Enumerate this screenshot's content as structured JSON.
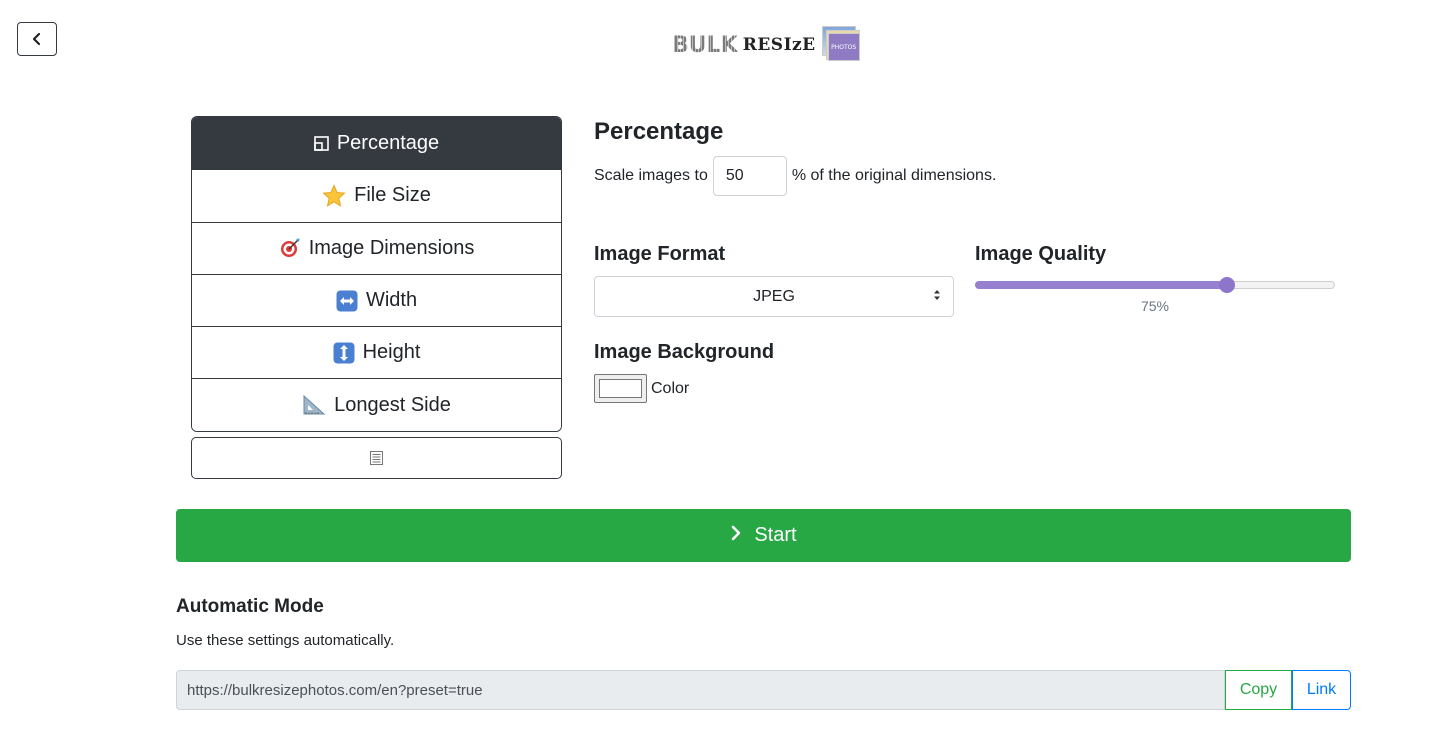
{
  "header": {
    "logo_bulk": "BULK",
    "logo_resize": "RESIzE",
    "logo_photos": "PHOTOS"
  },
  "menu": {
    "items": [
      {
        "label": "Percentage",
        "icon": "percentage-icon"
      },
      {
        "label": "File Size",
        "icon": "star-icon"
      },
      {
        "label": "Image Dimensions",
        "icon": "target-icon"
      },
      {
        "label": "Width",
        "icon": "left-right-arrow-icon"
      },
      {
        "label": "Height",
        "icon": "up-down-arrow-icon"
      },
      {
        "label": "Longest Side",
        "icon": "triangle-ruler-icon"
      }
    ]
  },
  "percentage": {
    "title": "Percentage",
    "prefix": "Scale images to",
    "value": "50",
    "suffix": "% of the original dimensions."
  },
  "format": {
    "title": "Image Format",
    "selected": "JPEG"
  },
  "quality": {
    "title": "Image Quality",
    "value": 75,
    "label": "75%"
  },
  "background": {
    "title": "Image Background",
    "color_label": "Color",
    "color": "#ffffff"
  },
  "start": {
    "label": "Start"
  },
  "auto": {
    "title": "Automatic Mode",
    "description": "Use these settings automatically.",
    "url": "https://bulkresizephotos.com/en?preset=true",
    "copy_label": "Copy",
    "link_label": "Link"
  },
  "colors": {
    "dark": "#343a40",
    "green": "#28a745",
    "blue": "#007bff",
    "slider": "#8e75cc"
  }
}
